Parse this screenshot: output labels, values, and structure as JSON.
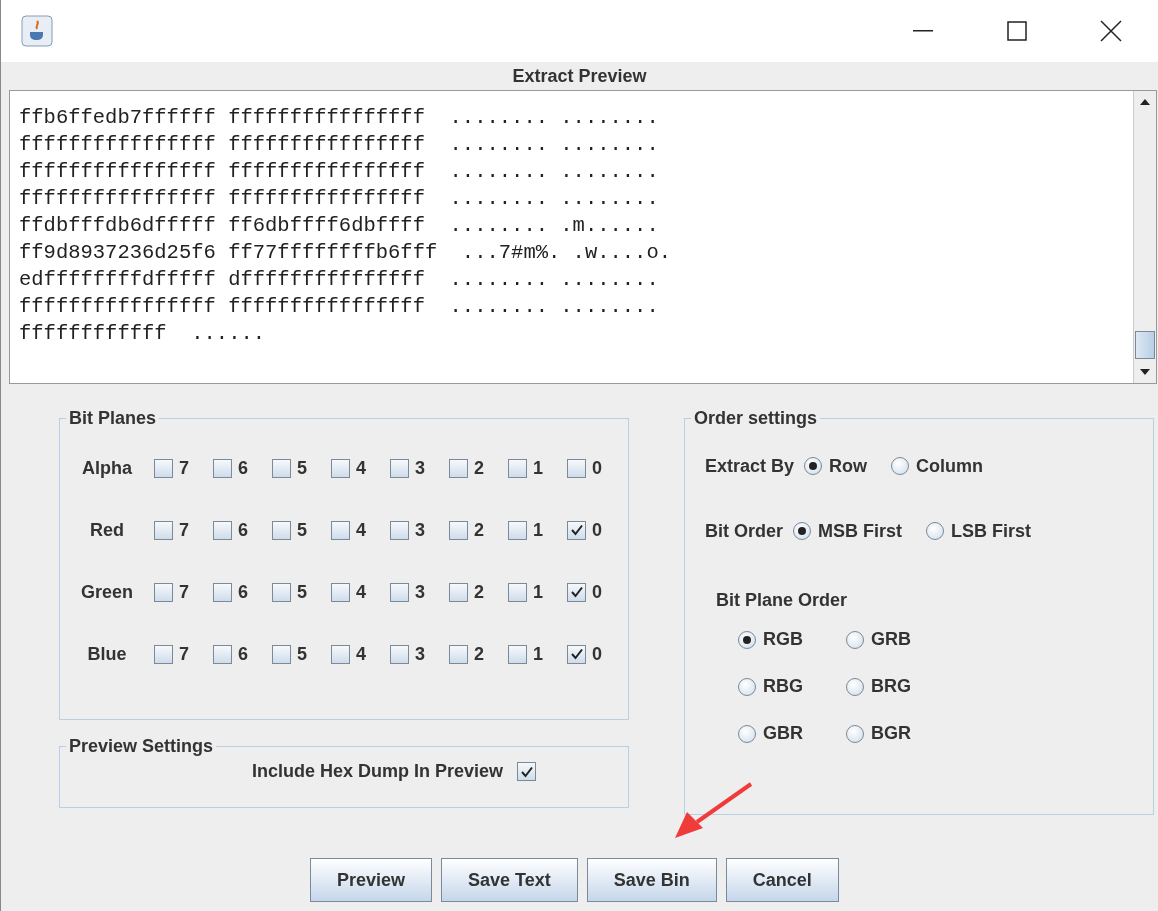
{
  "window": {
    "title": "Extract Preview"
  },
  "preview": {
    "lines": [
      "ffb6ffedb7ffffff ffffffffffffffff  ........ ........",
      "ffffffffffffffff ffffffffffffffff  ........ ........",
      "ffffffffffffffff ffffffffffffffff  ........ ........",
      "ffffffffffffffff ffffffffffffffff  ........ ........",
      "ffdbfffdb6dfffff ff6dbffff6dbffff  ........ .m......",
      "ff9d8937236d25f6 ff77ffffffffb6fff  ...7#m%. .w....o.",
      "edffffffffdfffff dfffffffffffffff  ........ ........",
      "ffffffffffffffff ffffffffffffffff  ........ ........",
      "ffffffffffff  ......"
    ]
  },
  "bit_planes": {
    "title": "Bit Planes",
    "rows": [
      {
        "label": "Alpha",
        "bits": [
          {
            "label": "7",
            "checked": false
          },
          {
            "label": "6",
            "checked": false
          },
          {
            "label": "5",
            "checked": false
          },
          {
            "label": "4",
            "checked": false
          },
          {
            "label": "3",
            "checked": false
          },
          {
            "label": "2",
            "checked": false
          },
          {
            "label": "1",
            "checked": false
          },
          {
            "label": "0",
            "checked": false
          }
        ]
      },
      {
        "label": "Red",
        "bits": [
          {
            "label": "7",
            "checked": false
          },
          {
            "label": "6",
            "checked": false
          },
          {
            "label": "5",
            "checked": false
          },
          {
            "label": "4",
            "checked": false
          },
          {
            "label": "3",
            "checked": false
          },
          {
            "label": "2",
            "checked": false
          },
          {
            "label": "1",
            "checked": false
          },
          {
            "label": "0",
            "checked": true
          }
        ]
      },
      {
        "label": "Green",
        "bits": [
          {
            "label": "7",
            "checked": false
          },
          {
            "label": "6",
            "checked": false
          },
          {
            "label": "5",
            "checked": false
          },
          {
            "label": "4",
            "checked": false
          },
          {
            "label": "3",
            "checked": false
          },
          {
            "label": "2",
            "checked": false
          },
          {
            "label": "1",
            "checked": false
          },
          {
            "label": "0",
            "checked": true
          }
        ]
      },
      {
        "label": "Blue",
        "bits": [
          {
            "label": "7",
            "checked": false
          },
          {
            "label": "6",
            "checked": false
          },
          {
            "label": "5",
            "checked": false
          },
          {
            "label": "4",
            "checked": false
          },
          {
            "label": "3",
            "checked": false
          },
          {
            "label": "2",
            "checked": false
          },
          {
            "label": "1",
            "checked": false
          },
          {
            "label": "0",
            "checked": true
          }
        ]
      }
    ]
  },
  "preview_settings": {
    "title": "Preview Settings",
    "option": {
      "label": "Include Hex Dump In Preview",
      "checked": true
    }
  },
  "order_settings": {
    "title": "Order settings",
    "extract_by": {
      "label": "Extract By",
      "options": [
        {
          "label": "Row",
          "selected": true
        },
        {
          "label": "Column",
          "selected": false
        }
      ]
    },
    "bit_order": {
      "label": "Bit Order",
      "options": [
        {
          "label": "MSB First",
          "selected": true
        },
        {
          "label": "LSB First",
          "selected": false
        }
      ]
    },
    "bit_plane_order": {
      "label": "Bit Plane Order",
      "options": [
        {
          "label": "RGB",
          "selected": true
        },
        {
          "label": "GRB",
          "selected": false
        },
        {
          "label": "RBG",
          "selected": false
        },
        {
          "label": "BRG",
          "selected": false
        },
        {
          "label": "GBR",
          "selected": false
        },
        {
          "label": "BGR",
          "selected": false
        }
      ]
    }
  },
  "buttons": [
    "Preview",
    "Save Text",
    "Save Bin",
    "Cancel"
  ]
}
